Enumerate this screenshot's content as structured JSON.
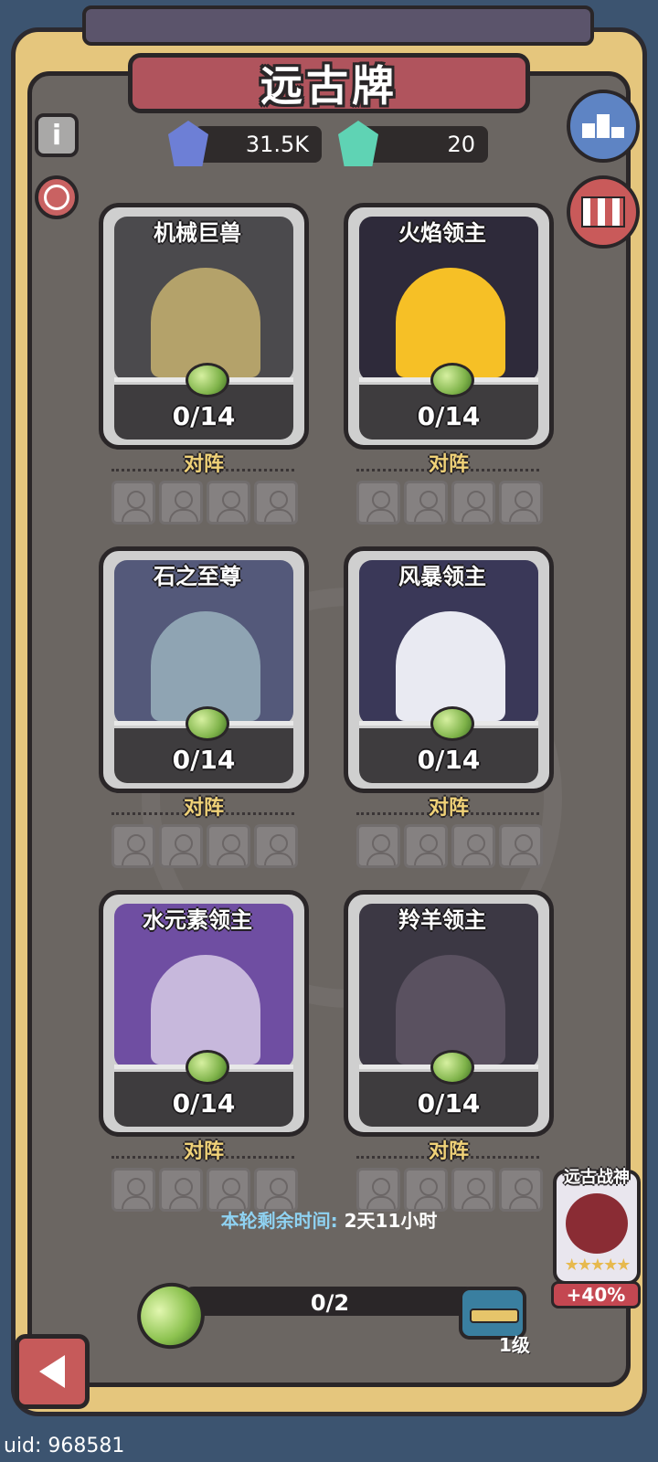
{
  "header": {
    "title": "远古牌"
  },
  "resources": {
    "blue_gem_amount": "31.5K",
    "green_gem_amount": "20"
  },
  "side_buttons": {
    "info_label": "i"
  },
  "cards": [
    {
      "name": "机械巨兽",
      "count": "0/14",
      "formation_label": "对阵",
      "art_bg": "#4b4a4d",
      "figure_color": "#b4a26a"
    },
    {
      "name": "火焰领主",
      "count": "0/14",
      "formation_label": "对阵",
      "art_bg": "#2e2a3a",
      "figure_color": "#f6c026"
    },
    {
      "name": "石之至尊",
      "count": "0/14",
      "formation_label": "对阵",
      "art_bg": "#54597a",
      "figure_color": "#8fa4b3"
    },
    {
      "name": "风暴领主",
      "count": "0/14",
      "formation_label": "对阵",
      "art_bg": "#3a3858",
      "figure_color": "#e9eaf2"
    },
    {
      "name": "水元素领主",
      "count": "0/14",
      "formation_label": "对阵",
      "art_bg": "#6f4ea2",
      "figure_color": "#c7b8dc"
    },
    {
      "name": "羚羊领主",
      "count": "0/14",
      "formation_label": "对阵",
      "art_bg": "#3c3844",
      "figure_color": "#5a5160"
    }
  ],
  "footer": {
    "timer_label": "本轮剩余时间:",
    "timer_value": "2天11小时",
    "progress_text": "0/2",
    "progress_fraction": 0,
    "chest_level": "1级"
  },
  "bonus_card": {
    "title": "远古战神",
    "stars": "★★★★★",
    "bonus": "+40%"
  },
  "uid_label": "uid: 968581",
  "colors": {
    "accent_gold": "#f0d278",
    "timer_blue": "#8fd2f2",
    "bean_green": "#9bd35a",
    "card_frame": "#cfcfcf"
  }
}
